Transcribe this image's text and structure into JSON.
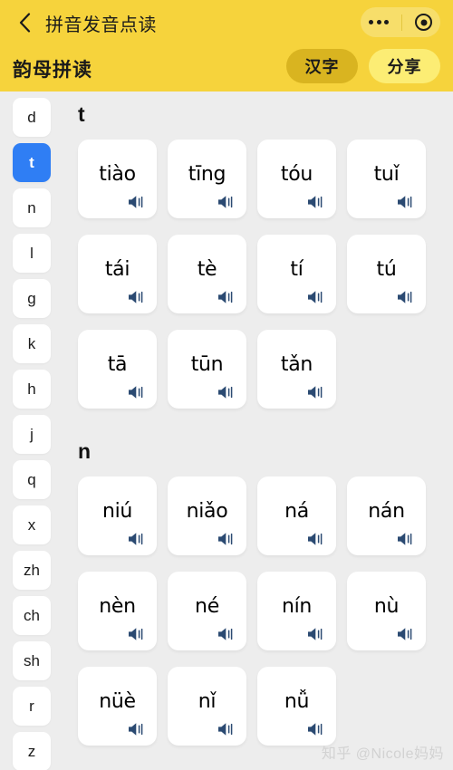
{
  "header": {
    "back_icon": "chevron-left-icon",
    "title": "拼音发音点读",
    "capsule": {
      "more_icon": "more-dots-icon",
      "target_icon": "target-circle-icon"
    },
    "sub_title": "韵母拼读",
    "hanzi_button": "汉字",
    "share_button": "分享",
    "bg_color": "#f6d33c",
    "capsule_color": "#f7de6a",
    "hanzi_color": "#d9b420",
    "share_color": "#fced74"
  },
  "sidebar": {
    "active": "t",
    "active_color": "#2f7ef4",
    "items": [
      {
        "label": "d",
        "active": false
      },
      {
        "label": "t",
        "active": true
      },
      {
        "label": "n",
        "active": false
      },
      {
        "label": "l",
        "active": false
      },
      {
        "label": "g",
        "active": false
      },
      {
        "label": "k",
        "active": false
      },
      {
        "label": "h",
        "active": false
      },
      {
        "label": "j",
        "active": false
      },
      {
        "label": "q",
        "active": false
      },
      {
        "label": "x",
        "active": false
      },
      {
        "label": "zh",
        "active": false
      },
      {
        "label": "ch",
        "active": false
      },
      {
        "label": "sh",
        "active": false
      },
      {
        "label": "r",
        "active": false
      },
      {
        "label": "z",
        "active": false
      }
    ]
  },
  "sections": [
    {
      "title": "t",
      "cards": [
        {
          "text": "tiào",
          "icon": "speaker-icon"
        },
        {
          "text": "tīng",
          "icon": "speaker-icon"
        },
        {
          "text": "tóu",
          "icon": "speaker-icon"
        },
        {
          "text": "tuǐ",
          "icon": "speaker-icon"
        },
        {
          "text": "tái",
          "icon": "speaker-icon"
        },
        {
          "text": "tè",
          "icon": "speaker-icon"
        },
        {
          "text": "tí",
          "icon": "speaker-icon"
        },
        {
          "text": "tú",
          "icon": "speaker-icon"
        },
        {
          "text": "tā",
          "icon": "speaker-icon"
        },
        {
          "text": "tūn",
          "icon": "speaker-icon"
        },
        {
          "text": "tǎn",
          "icon": "speaker-icon"
        }
      ]
    },
    {
      "title": "n",
      "cards": [
        {
          "text": "niú",
          "icon": "speaker-icon"
        },
        {
          "text": "niǎo",
          "icon": "speaker-icon"
        },
        {
          "text": "ná",
          "icon": "speaker-icon"
        },
        {
          "text": "nán",
          "icon": "speaker-icon"
        },
        {
          "text": "nèn",
          "icon": "speaker-icon"
        },
        {
          "text": "né",
          "icon": "speaker-icon"
        },
        {
          "text": "nín",
          "icon": "speaker-icon"
        },
        {
          "text": "nù",
          "icon": "speaker-icon"
        },
        {
          "text": "nüè",
          "icon": "speaker-icon"
        },
        {
          "text": "nǐ",
          "icon": "speaker-icon"
        },
        {
          "text": "nǚ",
          "icon": "speaker-icon"
        }
      ]
    }
  ],
  "watermark": "知乎 @Nicole妈妈"
}
